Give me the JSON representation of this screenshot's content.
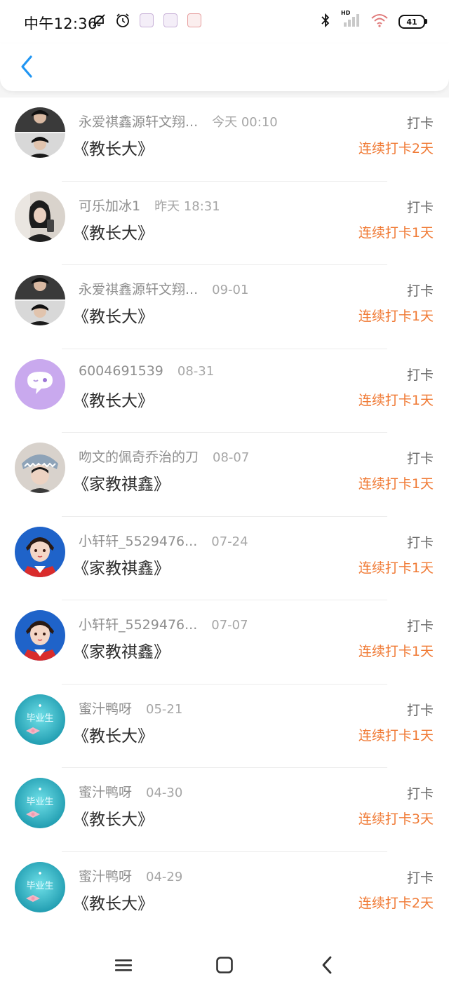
{
  "status": {
    "time": "中午12:36",
    "battery": "41",
    "signal_label": "HD"
  },
  "header": {
    "back_icon": "chevron-left-icon"
  },
  "records": [
    {
      "user": "永爱祺鑫源轩文翔...",
      "date": "今天 00:10",
      "book": "《教长大》",
      "tag": "打卡",
      "streak": "连续打卡2天",
      "avatar": "photo-two-boys"
    },
    {
      "user": "可乐加冰1",
      "date": "昨天 18:31",
      "book": "《教长大》",
      "tag": "打卡",
      "streak": "连续打卡1天",
      "avatar": "photo-girl-mirror"
    },
    {
      "user": "永爱祺鑫源轩文翔...",
      "date": "09-01",
      "book": "《教长大》",
      "tag": "打卡",
      "streak": "连续打卡1天",
      "avatar": "photo-two-boys"
    },
    {
      "user": "6004691539",
      "date": "08-31",
      "book": "《教长大》",
      "tag": "打卡",
      "streak": "连续打卡1天",
      "avatar": "default-chat-avatar"
    },
    {
      "user": "吻文的佩奇乔治的刀",
      "date": "08-07",
      "book": "《家教祺鑫》",
      "tag": "打卡",
      "streak": "连续打卡1天",
      "avatar": "photo-shark-hat"
    },
    {
      "user": "小轩轩_5529476...",
      "date": "07-24",
      "book": "《家教祺鑫》",
      "tag": "打卡",
      "streak": "连续打卡1天",
      "avatar": "illustration-boy"
    },
    {
      "user": "小轩轩_5529476...",
      "date": "07-07",
      "book": "《家教祺鑫》",
      "tag": "打卡",
      "streak": "连续打卡1天",
      "avatar": "illustration-boy"
    },
    {
      "user": "蜜汁鸭呀",
      "date": "05-21",
      "book": "《教长大》",
      "tag": "打卡",
      "streak": "连续打卡1天",
      "avatar": "teal-graduate-bow"
    },
    {
      "user": "蜜汁鸭呀",
      "date": "04-30",
      "book": "《教长大》",
      "tag": "打卡",
      "streak": "连续打卡3天",
      "avatar": "teal-graduate-bow"
    },
    {
      "user": "蜜汁鸭呀",
      "date": "04-29",
      "book": "《教长大》",
      "tag": "打卡",
      "streak": "连续打卡2天",
      "avatar": "teal-graduate-bow"
    }
  ],
  "colors": {
    "accent": "#2196f3",
    "streak": "#f07a35",
    "muted": "#8f8f8f"
  }
}
